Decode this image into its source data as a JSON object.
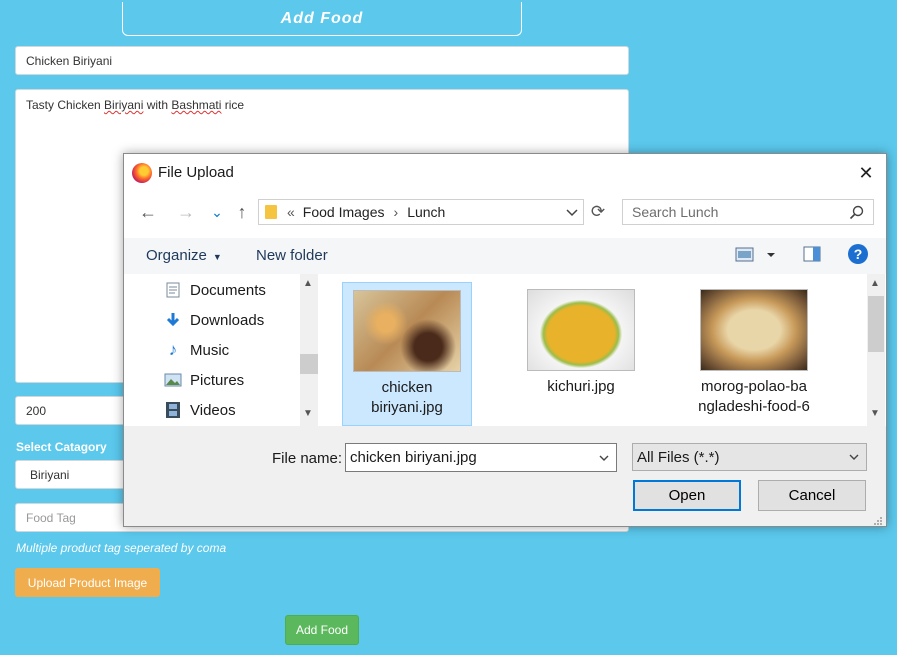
{
  "form": {
    "heading": "Add Food",
    "food_name": "Chicken Biriyani",
    "description_parts": [
      "Tasty Chicken ",
      "Biriyani",
      " with ",
      "Bashmati",
      " rice"
    ],
    "price": "200",
    "category_label": "Select Catagory",
    "category_value": "Biriyani",
    "tag_placeholder": "Food Tag",
    "tag_hint": "Multiple product tag seperated by coma",
    "upload_label": "Upload Product Image",
    "submit_label": "Add Food"
  },
  "dialog": {
    "title": "File Upload",
    "close_glyph": "✕",
    "nav": {
      "back": "←",
      "forward": "→",
      "recent": "⌄",
      "up": "↑",
      "refresh": "⟳"
    },
    "address": {
      "chevrons": "«",
      "path": [
        "Food Images",
        "Lunch"
      ],
      "separator": "›"
    },
    "search_placeholder": "Search Lunch",
    "toolbar": {
      "organize": "Organize",
      "new_folder": "New folder",
      "help": "?"
    },
    "sidebar": [
      {
        "label": "Documents",
        "icon": "documents-icon"
      },
      {
        "label": "Downloads",
        "icon": "downloads-icon"
      },
      {
        "label": "Music",
        "icon": "music-icon"
      },
      {
        "label": "Pictures",
        "icon": "pictures-icon"
      },
      {
        "label": "Videos",
        "icon": "videos-icon"
      }
    ],
    "files": [
      {
        "line1": "chicken",
        "line2": "biriyani.jpg",
        "selected": true
      },
      {
        "line1": "kichuri.jpg",
        "line2": "",
        "selected": false
      },
      {
        "line1": "morog-polao-ba",
        "line2": "ngladeshi-food-6",
        "selected": false
      }
    ],
    "file_name_label": "File name:",
    "file_name_value": "chicken biriyani.jpg",
    "file_type": "All Files (*.*)",
    "open_label": "Open",
    "cancel_label": "Cancel"
  },
  "colors": {
    "page_bg": "#5bc8ec",
    "upload_button": "#f0ad4e",
    "submit_button": "#5cb85c",
    "selection": "#cce8ff",
    "help_icon": "#1c6fd1"
  }
}
